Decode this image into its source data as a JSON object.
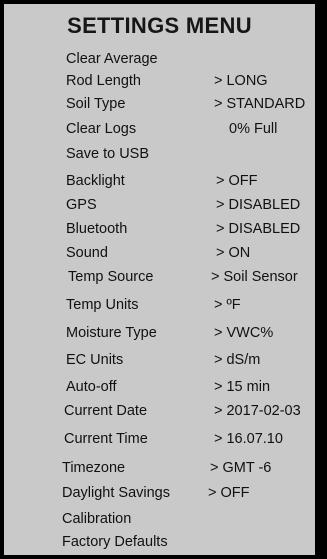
{
  "title": "SETTINGS MENU",
  "items": [
    {
      "label": "Clear Average",
      "value": ""
    },
    {
      "label": "Rod Length",
      "value": "> LONG"
    },
    {
      "label": "Soil Type",
      "value": "> STANDARD"
    },
    {
      "label": "Clear Logs",
      "value": "0% Full"
    },
    {
      "label": "Save to USB",
      "value": ""
    },
    {
      "label": "Backlight",
      "value": "> OFF"
    },
    {
      "label": "GPS",
      "value": "> DISABLED"
    },
    {
      "label": "Bluetooth",
      "value": "> DISABLED"
    },
    {
      "label": "Sound",
      "value": "> ON"
    },
    {
      "label": "Temp Source",
      "value": "> Soil Sensor"
    },
    {
      "label": "Temp Units",
      "value": "> ºF"
    },
    {
      "label": "Moisture Type",
      "value": "> VWC%"
    },
    {
      "label": "EC Units",
      "value": "> dS/m"
    },
    {
      "label": "Auto-off",
      "value": "> 15 min"
    },
    {
      "label": "Current Date",
      "value": "> 2017-02-03"
    },
    {
      "label": "Current Time",
      "value": "> 16.07.10"
    },
    {
      "label": "Timezone",
      "value": "> GMT -6"
    },
    {
      "label": "Daylight Savings",
      "value": "> OFF"
    },
    {
      "label": "Calibration",
      "value": ""
    },
    {
      "label": "Factory Defaults",
      "value": ""
    }
  ]
}
